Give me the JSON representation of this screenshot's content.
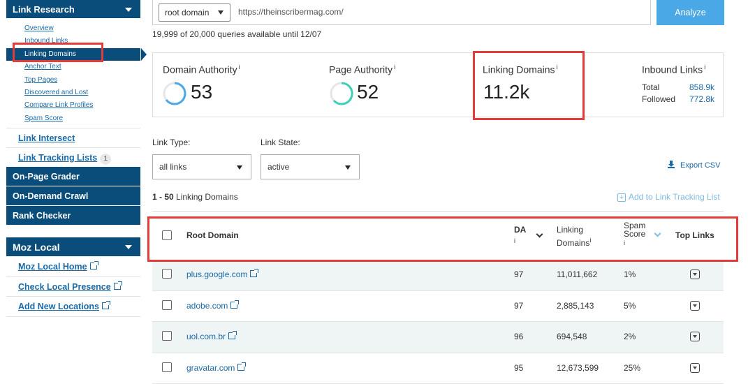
{
  "sidebar": {
    "link_research": "Link Research",
    "sub_items": [
      "Overview",
      "Inbound Links",
      "Linking Domains",
      "Anchor Text",
      "Top Pages",
      "Discovered and Lost",
      "Compare Link Profiles",
      "Spam Score"
    ],
    "link_intersect": "Link Intersect",
    "link_tracking": "Link Tracking Lists",
    "link_tracking_count": "1",
    "blocks": [
      "On-Page Grader",
      "On-Demand Crawl",
      "Rank Checker"
    ],
    "moz_local": "Moz Local",
    "local_items": [
      "Moz Local Home",
      "Check Local Presence",
      "Add New Locations"
    ]
  },
  "search": {
    "scope": "root domain",
    "url": "https://theinscribermag.com/",
    "analyze": "Analyze"
  },
  "quota": "19,999 of 20,000 queries available until 12/07",
  "metrics": {
    "da_label": "Domain Authority",
    "da_value": "53",
    "pa_label": "Page Authority",
    "pa_value": "52",
    "ld_label": "Linking Domains",
    "ld_value": "11.2k",
    "il_label": "Inbound Links",
    "total_label": "Total",
    "total_value": "858.9k",
    "followed_label": "Followed",
    "followed_value": "772.8k",
    "info": "i"
  },
  "filters": {
    "link_type_label": "Link Type:",
    "link_type_value": "all links",
    "link_state_label": "Link State:",
    "link_state_value": "active",
    "export": "Export CSV"
  },
  "results": {
    "range": "1 - 50",
    "range_label": "Linking Domains",
    "add_list": "Add to Link Tracking List"
  },
  "table": {
    "headers": {
      "root_domain": "Root Domain",
      "da": "DA",
      "linking": "Linking",
      "domains": "Domains",
      "spam": "Spam",
      "score": "Score",
      "top_links": "Top Links"
    },
    "rows": [
      {
        "domain": "plus.google.com",
        "da": "97",
        "linking": "11,011,662",
        "spam": "1%"
      },
      {
        "domain": "adobe.com",
        "da": "97",
        "linking": "2,885,143",
        "spam": "5%"
      },
      {
        "domain": "uol.com.br",
        "da": "96",
        "linking": "694,548",
        "spam": "2%"
      },
      {
        "domain": "gravatar.com",
        "da": "95",
        "linking": "12,673,599",
        "spam": "25%"
      }
    ]
  },
  "colors": {
    "nav_bg": "#0a4d7a",
    "link": "#1a6aa8",
    "analyze_bg": "#4aa8e6",
    "highlight": "#e53a3a",
    "da_ring": "#4aa8e6",
    "pa_ring": "#3ecfb6"
  }
}
